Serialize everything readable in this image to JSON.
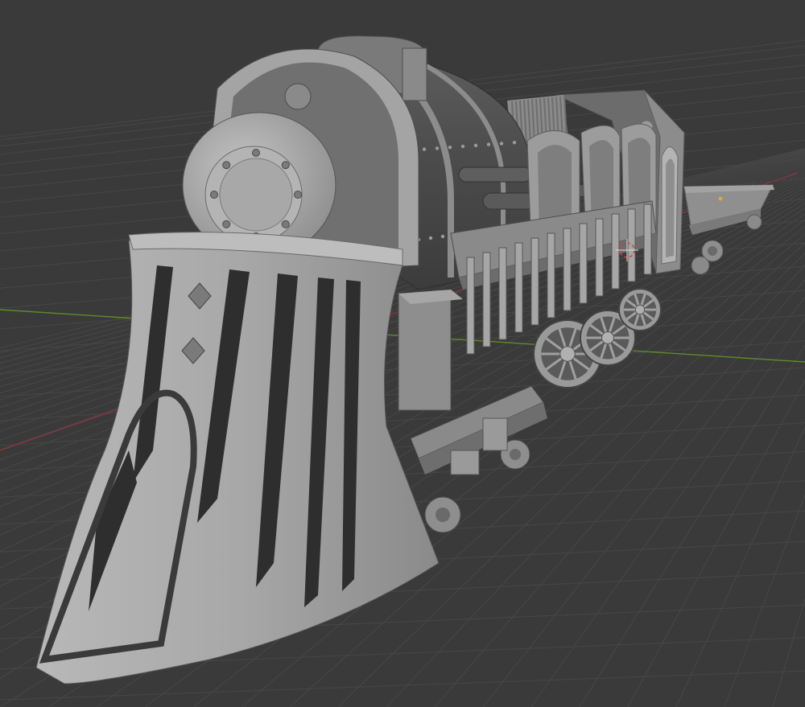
{
  "viewport": {
    "background": "#3a3a3a",
    "grid_color": "#4a4a4a",
    "x_axis_color": "#a33a44",
    "y_axis_color": "#6a9a2e",
    "model_color": "#9e9e9e",
    "origin_color": "#e8a33a"
  },
  "scene": {
    "object": "steam-locomotive-model",
    "cars": [
      "locomotive",
      "tender-car"
    ]
  }
}
